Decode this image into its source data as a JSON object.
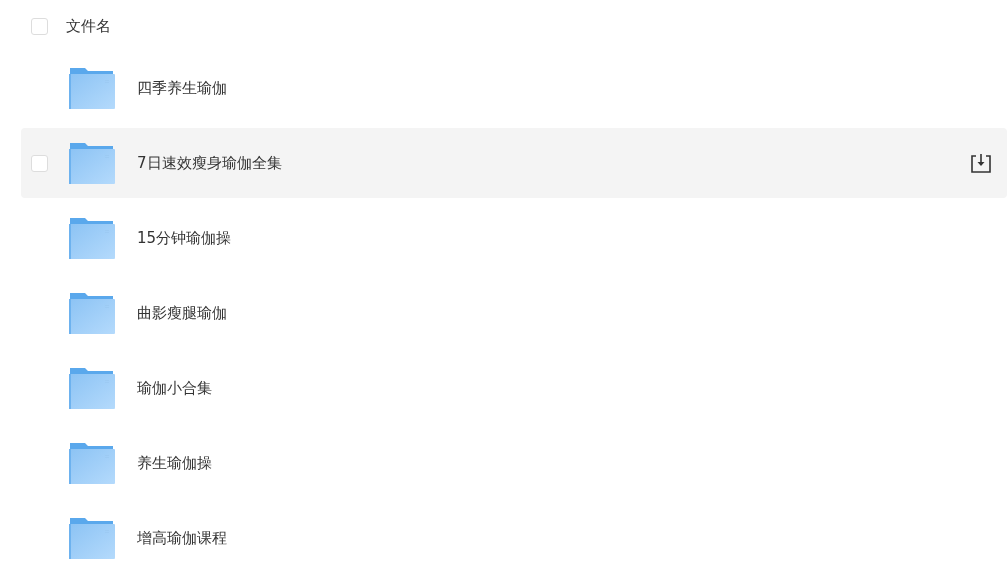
{
  "header": {
    "label": "文件名",
    "checked": false
  },
  "rows": [
    {
      "name": "四季养生瑜伽",
      "hovered": false
    },
    {
      "name": "7日速效瘦身瑜伽全集",
      "hovered": true
    },
    {
      "name": "15分钟瑜伽操",
      "hovered": false
    },
    {
      "name": "曲影瘦腿瑜伽",
      "hovered": false
    },
    {
      "name": "瑜伽小合集",
      "hovered": false
    },
    {
      "name": "养生瑜伽操",
      "hovered": false
    },
    {
      "name": "增高瑜伽课程",
      "hovered": false
    }
  ]
}
